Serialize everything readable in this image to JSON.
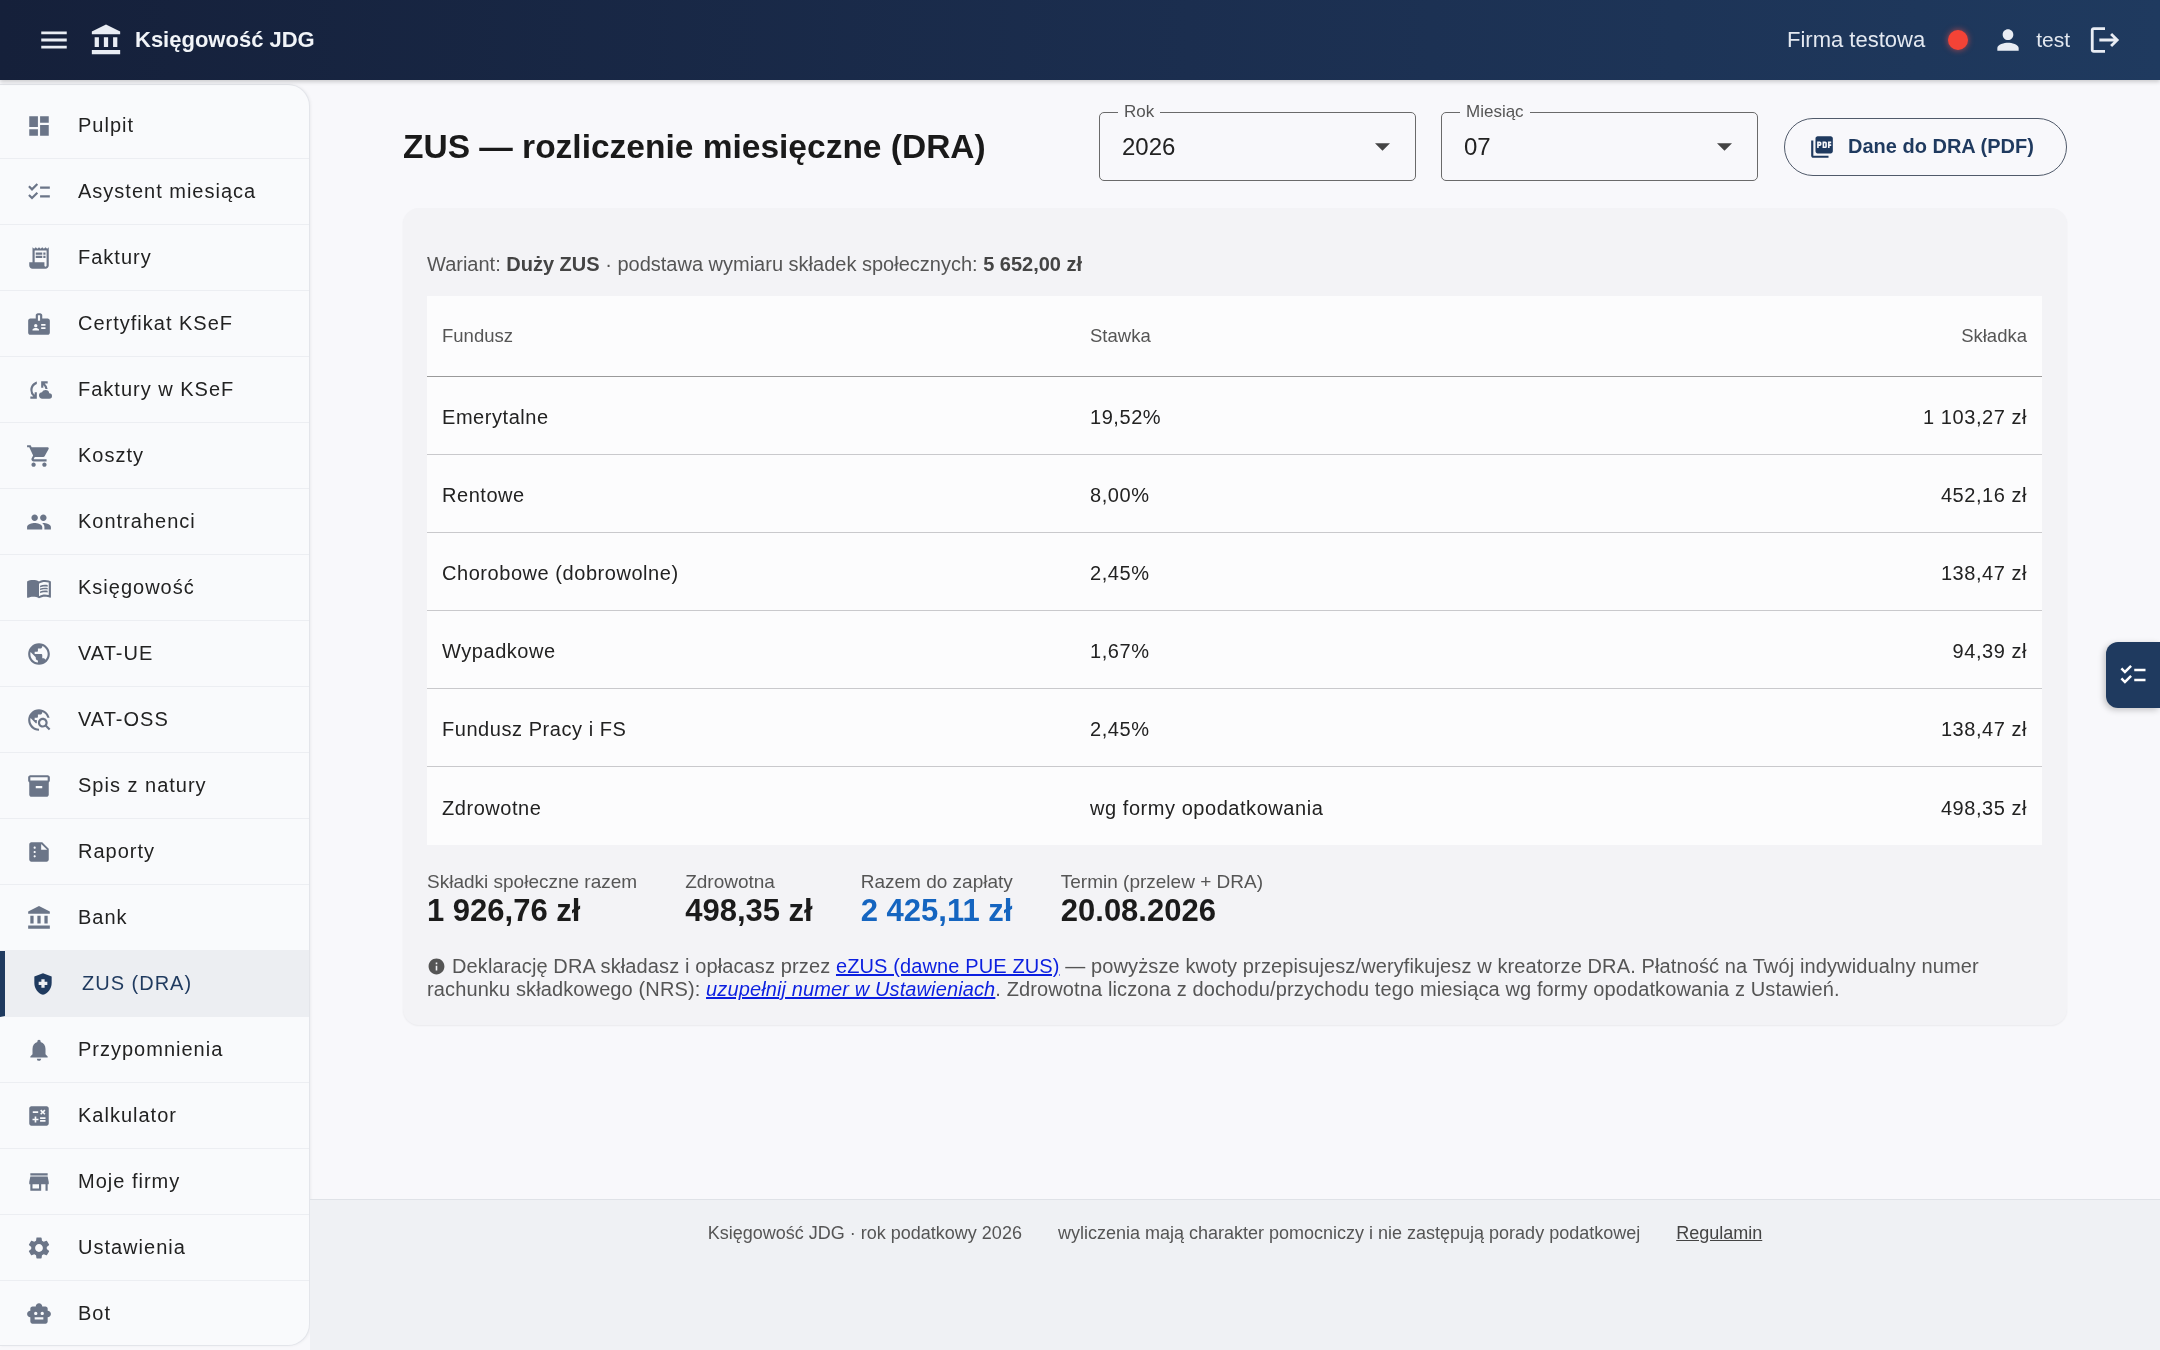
{
  "top_bar": {
    "title": "Księgowość JDG",
    "company": "Firma testowa",
    "user": "test"
  },
  "sidebar": {
    "items": [
      {
        "label": "Pulpit",
        "selected": false
      },
      {
        "label": "Asystent miesiąca",
        "selected": false
      },
      {
        "label": "Faktury",
        "selected": false
      },
      {
        "label": "Certyfikat KSeF",
        "selected": false
      },
      {
        "label": "Faktury w KSeF",
        "selected": false
      },
      {
        "label": "Koszty",
        "selected": false
      },
      {
        "label": "Kontrahenci",
        "selected": false
      },
      {
        "label": "Księgowość",
        "selected": false
      },
      {
        "label": "VAT-UE",
        "selected": false
      },
      {
        "label": "VAT-OSS",
        "selected": false
      },
      {
        "label": "Spis z natury",
        "selected": false
      },
      {
        "label": "Raporty",
        "selected": false
      },
      {
        "label": "Bank",
        "selected": false
      },
      {
        "label": "ZUS (DRA)",
        "selected": true
      },
      {
        "label": "Przypomnienia",
        "selected": false
      },
      {
        "label": "Kalkulator",
        "selected": false
      },
      {
        "label": "Moje firmy",
        "selected": false
      },
      {
        "label": "Ustawienia",
        "selected": false
      },
      {
        "label": "Bot",
        "selected": false
      }
    ]
  },
  "page": {
    "title": "ZUS — rozliczenie miesięczne (DRA)",
    "selects": [
      {
        "label": "Rok",
        "value": "2026"
      },
      {
        "label": "Miesiąc",
        "value": "07"
      }
    ],
    "pdf_button": "Dane do DRA (PDF)"
  },
  "summary": {
    "variant_line": "Wariant: **Duży ZUS** · podstawa wymiaru składek społecznych: **5 652,00 zł**",
    "table": {
      "columns": [
        "Fundusz",
        "Stawka",
        "Składka"
      ],
      "rows": [
        [
          "Emerytalne",
          "19,52%",
          "1 103,27 zł"
        ],
        [
          "Rentowe",
          "8,00%",
          "452,16 zł"
        ],
        [
          "Chorobowe (dobrowolne)",
          "2,45%",
          "138,47 zł"
        ],
        [
          "Wypadkowe",
          "1,67%",
          "94,39 zł"
        ],
        [
          "Fundusz Pracy i FS",
          "2,45%",
          "138,47 zł"
        ],
        [
          "Zdrowotne",
          "wg formy opodatkowania",
          "498,35 zł"
        ]
      ]
    },
    "totals": [
      {
        "label": "Składki społeczne razem",
        "value": "1 926,76 zł",
        "highlight": false
      },
      {
        "label": "Zdrowotna",
        "value": "498,35 zł",
        "highlight": false
      },
      {
        "label": "Razem do zapłaty",
        "value": "2 425,11 zł",
        "highlight": true
      },
      {
        "label": "Termin (przelew + DRA)",
        "value": "20.08.2026",
        "highlight": false
      }
    ],
    "note": [
      {
        "kind": "text",
        "text": "Deklarację DRA składasz i opłacasz przez "
      },
      {
        "kind": "link",
        "text": "eZUS (dawne PUE ZUS)"
      },
      {
        "kind": "text",
        "text": " — powyższe kwoty przepisujesz/weryfikujesz w kreatorze DRA. Płatność na Twój indywidualny numer rachunku składkowego (NRS): "
      },
      {
        "kind": "italic_link",
        "text": "uzupełnij numer w Ustawieniach"
      },
      {
        "kind": "text",
        "text": ". Zdrowotna liczona z dochodu/przychodu tego miesiąca wg formy opodatkowania z Ustawień."
      }
    ]
  },
  "footer": {
    "texts": [
      "Księgowość JDG · rok podatkowy 2026",
      "wyliczenia mają charakter pomocniczy i nie zastępują porady podatkowej"
    ],
    "link": "Regulamin"
  }
}
